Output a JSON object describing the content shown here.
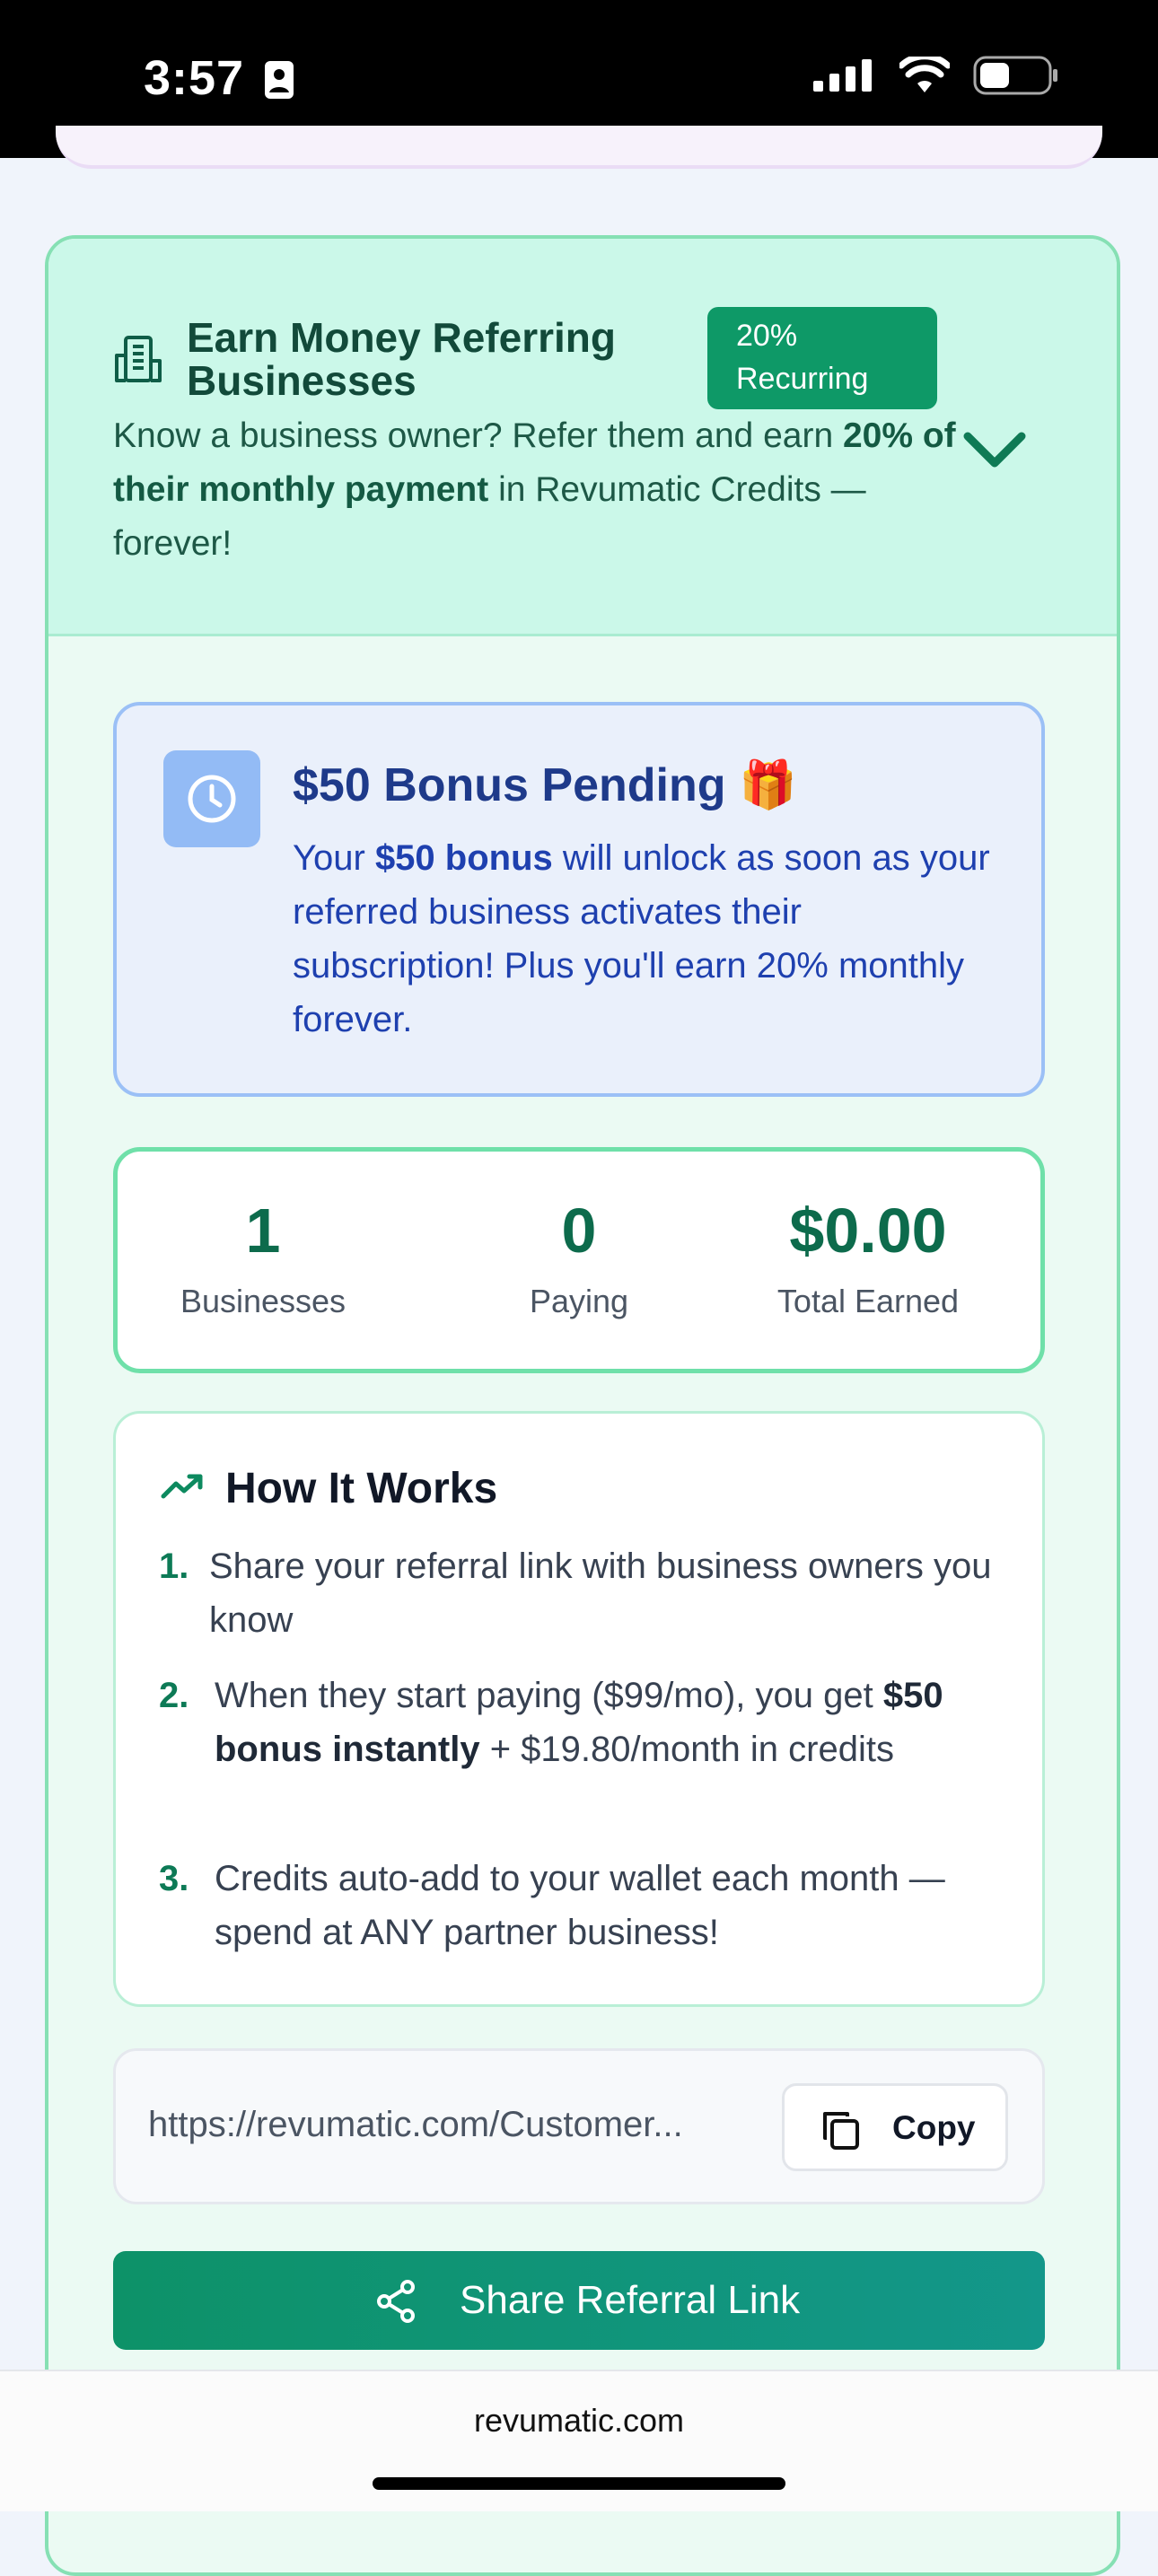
{
  "status_bar": {
    "time": "3:57",
    "icons": [
      "contact-card-icon",
      "cellular-signal-icon",
      "wifi-icon",
      "battery-icon"
    ]
  },
  "referral_card": {
    "header": {
      "title": "Earn Money Referring Businesses",
      "badge_line1": "20%",
      "badge_line2": "Recurring",
      "desc_part1": "Know a business owner? Refer them and earn ",
      "desc_bold": "20% of their monthly payment",
      "desc_part2": " in Revumatic Credits — forever!",
      "icon": "building-icon",
      "toggle_icon": "chevron-down-icon"
    },
    "bonus": {
      "title": "$50 Bonus Pending",
      "title_emoji": "🎁",
      "text_part1": "Your ",
      "text_bold": "$50 bonus",
      "text_part2": " will unlock as soon as your referred business activates their subscription! Plus you'll earn 20% monthly forever.",
      "icon": "clock-icon"
    },
    "stats": [
      {
        "value": "1",
        "label": "Businesses"
      },
      {
        "value": "0",
        "label": "Paying"
      },
      {
        "value": "$0.00",
        "label": "Total Earned"
      }
    ],
    "how_it_works": {
      "title": "How It Works",
      "icon": "trending-up-icon",
      "steps": [
        {
          "num": "1.",
          "text": "Share your referral link with business owners you know"
        },
        {
          "num": "2.",
          "text_part1": "When they start paying ($99/mo), you get ",
          "text_bold": "$50 bonus instantly",
          "text_part2": " + $19.80/month in credits"
        },
        {
          "num": "3.",
          "text": "Credits auto-add to your wallet each month — spend at ANY partner business!"
        }
      ]
    },
    "link": {
      "url": "https://revumatic.com/Customer...",
      "copy_label": "Copy"
    },
    "share_label": "Share Referral Link"
  },
  "browser": {
    "domain": "revumatic.com"
  },
  "colors": {
    "accent_green": "#0e9967",
    "header_bg": "#cbf8e9",
    "bonus_blue": "#1e3a8a"
  }
}
